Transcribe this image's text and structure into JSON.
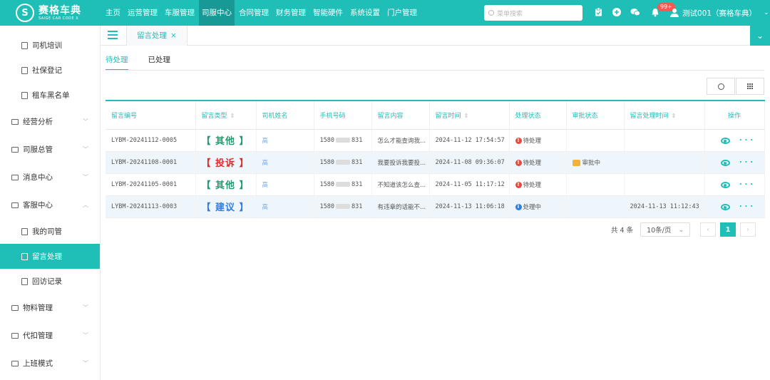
{
  "app": {
    "logo_cn": "赛格车典",
    "logo_en": "SAIGE CAR CODE X",
    "logo_mark": "S"
  },
  "topnav": [
    {
      "label": "主页"
    },
    {
      "label": "运营管理"
    },
    {
      "label": "车服管理"
    },
    {
      "label": "司服中心",
      "active": true
    },
    {
      "label": "合同管理"
    },
    {
      "label": "财务管理"
    },
    {
      "label": "智能硬件"
    },
    {
      "label": "系统设置"
    },
    {
      "label": "门户管理"
    }
  ],
  "search": {
    "placeholder": "菜单搜索"
  },
  "notifications": {
    "badge": "99+"
  },
  "user": {
    "name": "测试001（赛格车典）"
  },
  "sidebar": {
    "items": [
      {
        "label": "司机培训",
        "type": "sub"
      },
      {
        "label": "社保登记",
        "type": "sub"
      },
      {
        "label": "租车黑名单",
        "type": "sub"
      },
      {
        "label": "经营分析",
        "type": "group"
      },
      {
        "label": "司服总管",
        "type": "group"
      },
      {
        "label": "消息中心",
        "type": "group"
      },
      {
        "label": "客服中心",
        "type": "group",
        "expanded": true
      },
      {
        "label": "我的司管",
        "type": "sub"
      },
      {
        "label": "留言处理",
        "type": "sub",
        "active": true
      },
      {
        "label": "回访记录",
        "type": "sub"
      },
      {
        "label": "物料管理",
        "type": "group"
      },
      {
        "label": "代扣管理",
        "type": "group"
      },
      {
        "label": "上班模式",
        "type": "group"
      }
    ]
  },
  "tabs": [
    {
      "label": "留言处理",
      "close": "×"
    }
  ],
  "subtabs": [
    {
      "label": "待处理",
      "active": true
    },
    {
      "label": "已处理"
    }
  ],
  "table": {
    "headers": [
      "留言编号",
      "留言类型",
      "司机姓名",
      "手机号码",
      "留言内容",
      "留言时间",
      "处理状态",
      "审批状态",
      "留言处理时间",
      "操作"
    ],
    "sortable": [
      false,
      true,
      false,
      false,
      false,
      true,
      false,
      false,
      true,
      false
    ],
    "rows": [
      {
        "id": "LYBM-20241112-0005",
        "type": "【 其他 】",
        "type_color": "#1a9e6e",
        "name": "高",
        "phone_a": "1580",
        "phone_b": "831",
        "content": "怎么才能查询我...",
        "time": "2024-11-12 17:54:57",
        "status": "待处理",
        "status_kind": "red",
        "approval": "",
        "handled_time": ""
      },
      {
        "id": "LYBM-20241108-0001",
        "type": "【 投诉 】",
        "type_color": "#e02b2b",
        "name": "高",
        "phone_a": "1580",
        "phone_b": "831",
        "content": "我要投诉我要投...",
        "time": "2024-11-08 09:36:07",
        "status": "待处理",
        "status_kind": "red",
        "approval": "审批中",
        "handled_time": ""
      },
      {
        "id": "LYBM-20241105-0001",
        "type": "【 其他 】",
        "type_color": "#1a9e6e",
        "name": "高",
        "phone_a": "1580",
        "phone_b": "831",
        "content": "不知道该怎么查...",
        "time": "2024-11-05 11:17:12",
        "status": "待处理",
        "status_kind": "red",
        "approval": "",
        "handled_time": ""
      },
      {
        "id": "LYBM-20241113-0003",
        "type": "【 建议 】",
        "type_color": "#2f7fe0",
        "name": "高",
        "phone_a": "1580",
        "phone_b": "831",
        "content": "有违章的话能不...",
        "time": "2024-11-13 11:06:18",
        "status": "处理中",
        "status_kind": "blue",
        "approval": "",
        "handled_time": "2024-11-13 11:12:43"
      }
    ]
  },
  "pager": {
    "total": "共 4 条",
    "size": "10条/页",
    "current": "1"
  },
  "colors": {
    "brand": "#1fbfb8",
    "danger": "#e84a3c",
    "info": "#2f7fe0"
  }
}
